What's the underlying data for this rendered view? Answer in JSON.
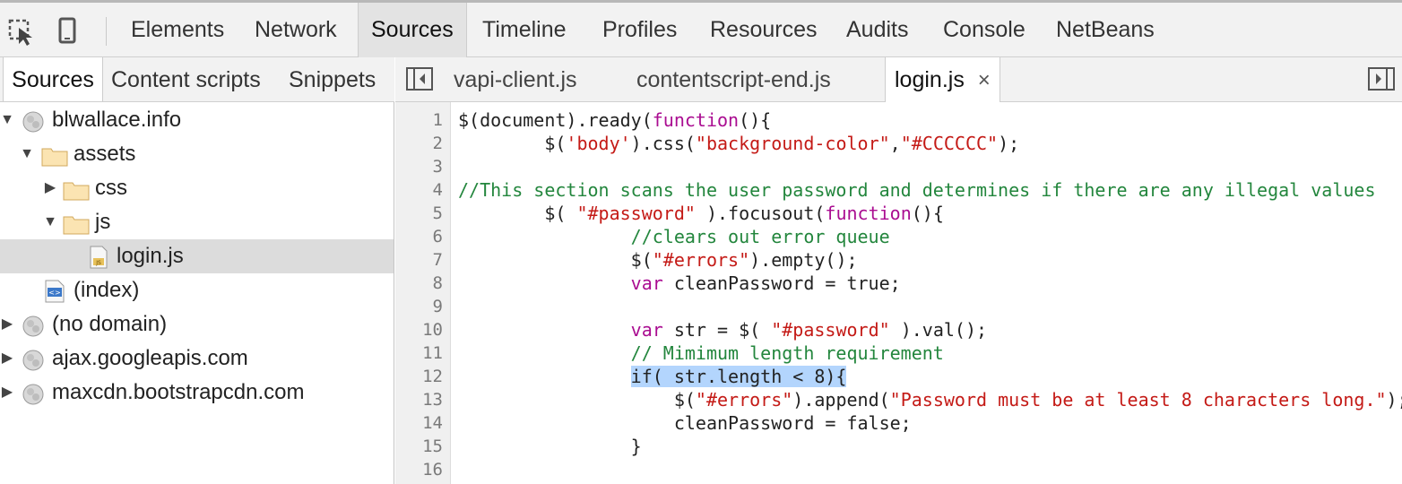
{
  "toolbar": {
    "tabs": [
      "Elements",
      "Network",
      "Sources",
      "Timeline",
      "Profiles",
      "Resources",
      "Audits",
      "Console",
      "NetBeans"
    ],
    "active_tab": "Sources",
    "inspect_icon": "inspect-cursor-icon",
    "device_icon": "mobile-device-icon"
  },
  "sidebar": {
    "tabs": [
      "Sources",
      "Content scripts",
      "Snippets"
    ],
    "tree": [
      {
        "label": "blwallace.info",
        "icon": "globe-icon"
      },
      {
        "label": "assets",
        "icon": "folder-icon"
      },
      {
        "label": "css",
        "icon": "folder-icon"
      },
      {
        "label": "js",
        "icon": "folder-icon"
      },
      {
        "label": "login.js",
        "icon": "js-file-icon"
      },
      {
        "label": "(index)",
        "icon": "html-file-icon"
      },
      {
        "label": "(no domain)",
        "icon": "globe-icon"
      },
      {
        "label": "ajax.googleapis.com",
        "icon": "globe-icon"
      },
      {
        "label": "maxcdn.bootstrapcdn.com",
        "icon": "globe-icon"
      }
    ]
  },
  "editor": {
    "tabs": [
      "vapi-client.js",
      "contentscript-end.js",
      "login.js"
    ],
    "active_tab": "login.js",
    "close_glyph": "×",
    "line_numbers": [
      "1",
      "2",
      "3",
      "4",
      "5",
      "6",
      "7",
      "8",
      "9",
      "10",
      "11",
      "12",
      "13",
      "14",
      "15",
      "16"
    ],
    "lines": [
      [
        {
          "t": "$(document).ready("
        },
        {
          "t": "function",
          "c": "kw"
        },
        {
          "t": "(){"
        }
      ],
      [
        {
          "t": "        $("
        },
        {
          "t": "'body'",
          "c": "str"
        },
        {
          "t": ").css("
        },
        {
          "t": "\"background-color\"",
          "c": "str"
        },
        {
          "t": ","
        },
        {
          "t": "\"#CCCCCC\"",
          "c": "str"
        },
        {
          "t": ");"
        }
      ],
      [],
      [
        {
          "t": "//This section scans the user password and determines if there are any illegal values",
          "c": "cm"
        }
      ],
      [
        {
          "t": "        $( "
        },
        {
          "t": "\"#password\"",
          "c": "str"
        },
        {
          "t": " ).focusout("
        },
        {
          "t": "function",
          "c": "kw"
        },
        {
          "t": "(){"
        }
      ],
      [
        {
          "t": "                //clears out error queue",
          "c": "cm"
        }
      ],
      [
        {
          "t": "                $("
        },
        {
          "t": "\"#errors\"",
          "c": "str"
        },
        {
          "t": ").empty();"
        }
      ],
      [
        {
          "t": "                "
        },
        {
          "t": "var",
          "c": "kw"
        },
        {
          "t": " cleanPassword = true;"
        }
      ],
      [],
      [
        {
          "t": "                "
        },
        {
          "t": "var",
          "c": "kw"
        },
        {
          "t": " str = $( "
        },
        {
          "t": "\"#password\"",
          "c": "str"
        },
        {
          "t": " ).val();"
        }
      ],
      [
        {
          "t": "                // Mimimum length requirement",
          "c": "cm"
        }
      ],
      [
        {
          "t": "                "
        },
        {
          "t": "if( str.length < 8){",
          "c": "hl"
        }
      ],
      [
        {
          "t": "                    $("
        },
        {
          "t": "\"#errors\"",
          "c": "str"
        },
        {
          "t": ").append("
        },
        {
          "t": "\"Password must be at least 8 characters long.\"",
          "c": "str"
        },
        {
          "t": ");"
        }
      ],
      [
        {
          "t": "                    cleanPassword = false;"
        }
      ],
      [
        {
          "t": "                }"
        }
      ],
      []
    ]
  }
}
